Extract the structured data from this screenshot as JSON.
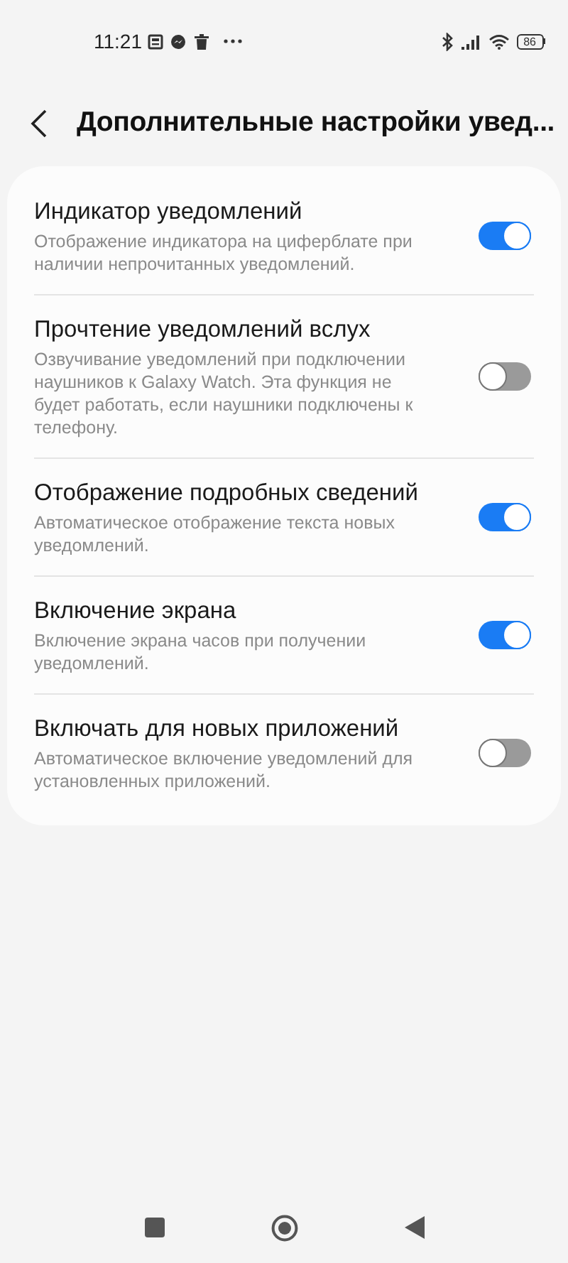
{
  "status_bar": {
    "time": "11:21",
    "battery": "86"
  },
  "header": {
    "title": "Дополнительные настройки увед..."
  },
  "settings": [
    {
      "title": "Индикатор уведомлений",
      "description": "Отображение индикатора на циферблате при наличии непрочитанных уведомлений.",
      "on": true
    },
    {
      "title": "Прочтение уведомлений вслух",
      "description": "Озвучивание уведомлений при подключении наушников к Galaxy Watch. Эта функция не будет работать, если наушники подключены к телефону.",
      "on": false
    },
    {
      "title": "Отображение подробных сведений",
      "description": "Автоматическое отображение текста новых уведомлений.",
      "on": true
    },
    {
      "title": "Включение экрана",
      "description": "Включение экрана часов при получении уведомлений.",
      "on": true
    },
    {
      "title": "Включать для новых приложений",
      "description": "Автоматическое включение уведомлений для установленных приложений.",
      "on": false
    }
  ]
}
